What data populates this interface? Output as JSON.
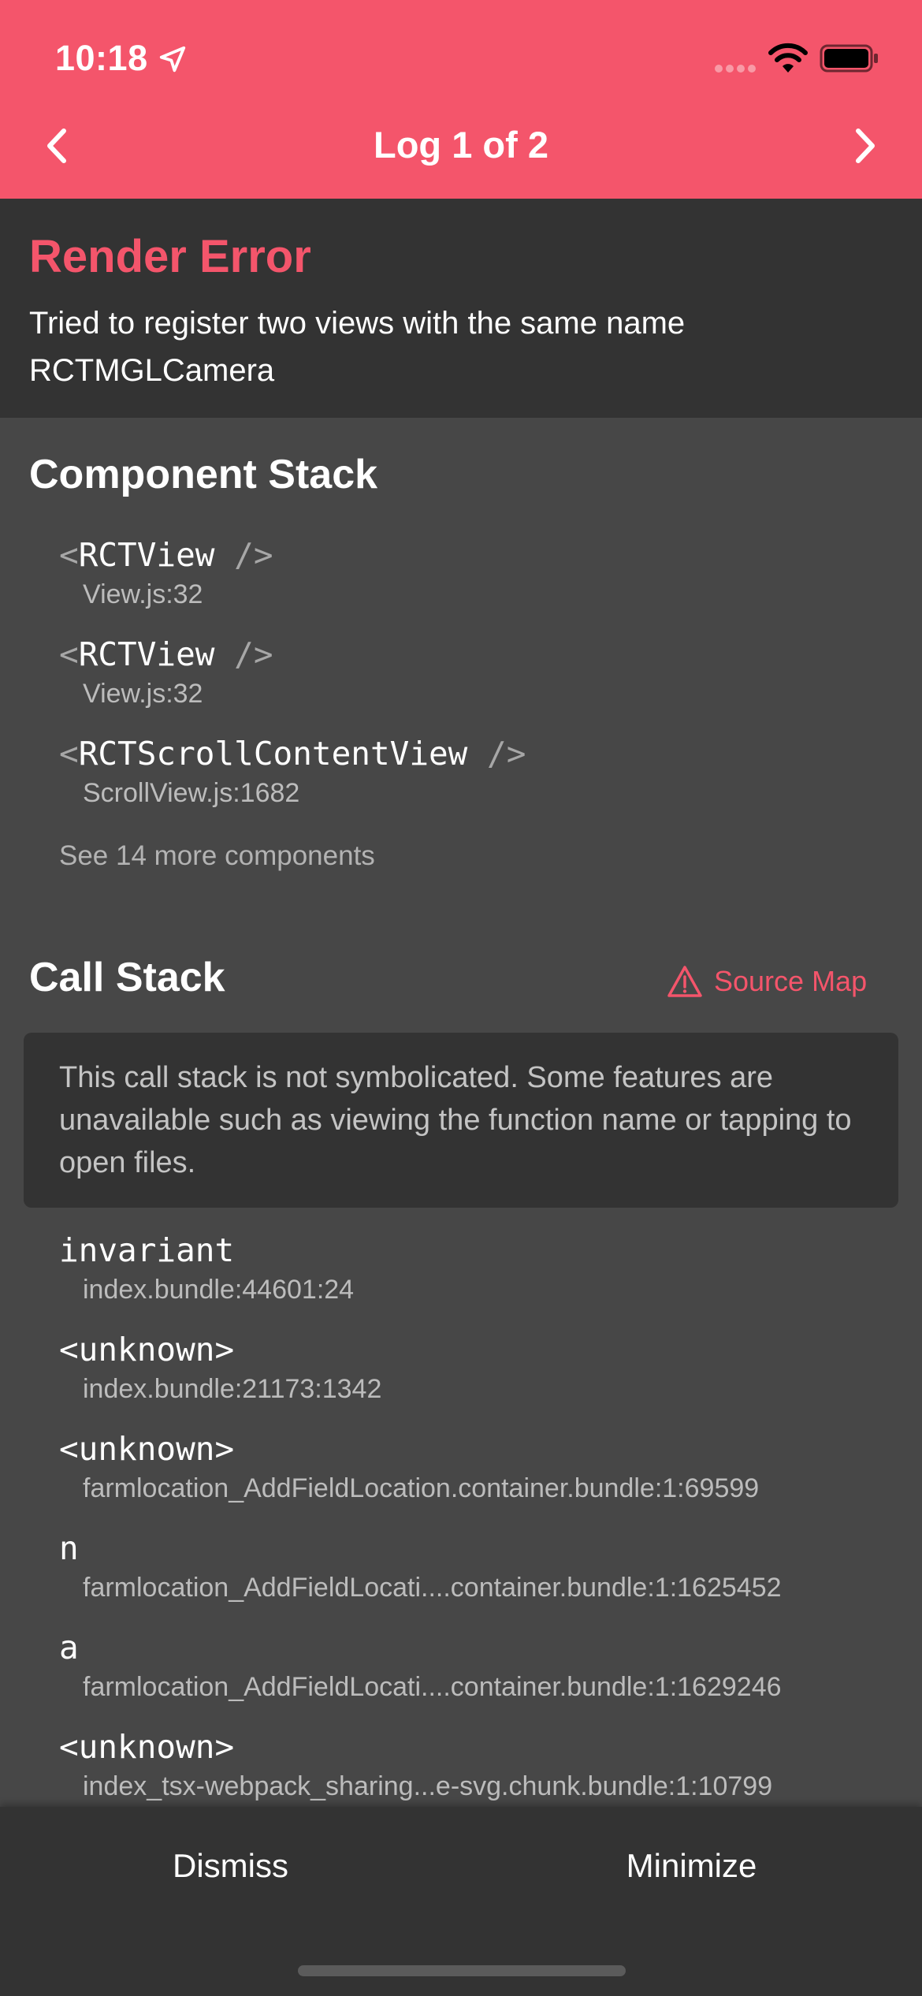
{
  "status_bar": {
    "time": "10:18"
  },
  "nav": {
    "title": "Log 1 of 2"
  },
  "error": {
    "title": "Render Error",
    "message": "Tried to register two views with the same name RCTMGLCamera"
  },
  "component_stack": {
    "title": "Component Stack",
    "frames": [
      {
        "name": "RCTView",
        "location": "View.js:32"
      },
      {
        "name": "RCTView",
        "location": "View.js:32"
      },
      {
        "name": "RCTScrollContentView",
        "location": "ScrollView.js:1682"
      }
    ],
    "see_more": "See 14 more components"
  },
  "call_stack": {
    "title": "Call Stack",
    "source_map_label": "Source Map",
    "notice": "This call stack is not symbolicated. Some features are unavailable such as viewing the function name or tapping to open files.",
    "frames": [
      {
        "name": "invariant",
        "location": "index.bundle:44601:24"
      },
      {
        "name": "<unknown>",
        "location": "index.bundle:21173:1342"
      },
      {
        "name": "<unknown>",
        "location": "farmlocation_AddFieldLocation.container.bundle:1:69599"
      },
      {
        "name": "n",
        "location": "farmlocation_AddFieldLocati....container.bundle:1:1625452"
      },
      {
        "name": "a",
        "location": "farmlocation_AddFieldLocati....container.bundle:1:1629246"
      },
      {
        "name": "<unknown>",
        "location": "index_tsx-webpack_sharing...e-svg.chunk.bundle:1:10799"
      }
    ]
  },
  "footer": {
    "dismiss_label": "Dismiss",
    "minimize_label": "Minimize"
  },
  "colors": {
    "accent": "#f4556b",
    "background": "#474747",
    "panel": "#333333"
  }
}
